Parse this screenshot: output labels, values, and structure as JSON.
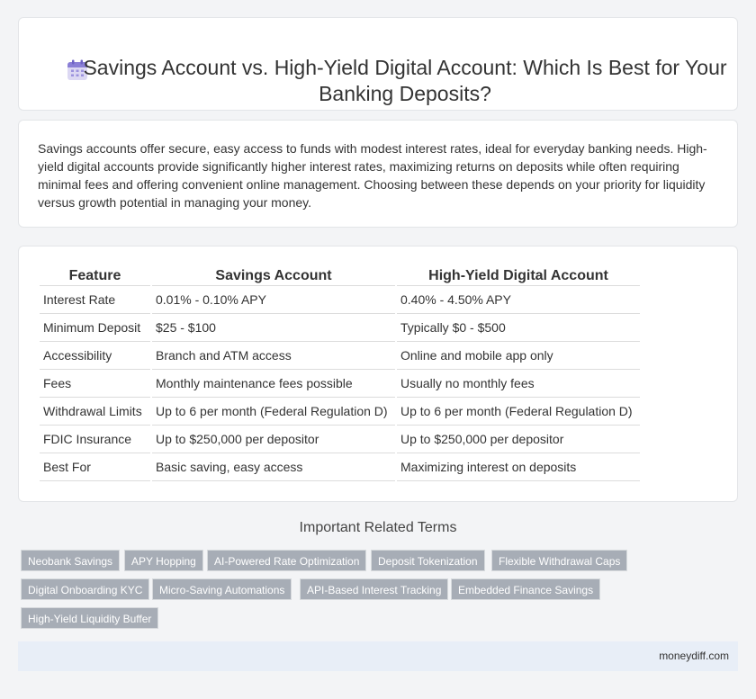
{
  "header": {
    "title": "Savings Account vs. High-Yield Digital Account: Which Is Best for Your Banking Deposits?",
    "icon": "calendar-icon"
  },
  "intro": {
    "text": "Savings accounts offer secure, easy access to funds with modest interest rates, ideal for everyday banking needs. High-yield digital accounts provide significantly higher interest rates, maximizing returns on deposits while often requiring minimal fees and offering convenient online management. Choosing between these depends on your priority for liquidity versus growth potential in managing your money."
  },
  "table": {
    "headers": [
      "Feature",
      "Savings Account",
      "High-Yield Digital Account"
    ],
    "rows": [
      [
        "Interest Rate",
        "0.01% - 0.10% APY",
        "0.40% - 4.50% APY"
      ],
      [
        "Minimum Deposit",
        "$25 - $100",
        "Typically $0 - $500"
      ],
      [
        "Accessibility",
        "Branch and ATM access",
        "Online and mobile app only"
      ],
      [
        "Fees",
        "Monthly maintenance fees possible",
        "Usually no monthly fees"
      ],
      [
        "Withdrawal Limits",
        "Up to 6 per month (Federal Regulation D)",
        "Up to 6 per month (Federal Regulation D)"
      ],
      [
        "FDIC Insurance",
        "Up to $250,000 per depositor",
        "Up to $250,000 per depositor"
      ],
      [
        "Best For",
        "Basic saving, easy access",
        "Maximizing interest on deposits"
      ]
    ]
  },
  "related": {
    "title": "Important Related Terms",
    "tags": [
      "Neobank Savings",
      "APY Hopping",
      "AI-Powered Rate Optimization",
      "Deposit Tokenization",
      "Flexible Withdrawal Caps",
      "Digital Onboarding KYC",
      "Micro-Saving Automations",
      "API-Based Interest Tracking",
      "Embedded Finance Savings",
      "High-Yield Liquidity Buffer"
    ]
  },
  "footer": {
    "site": "moneydiff.com"
  },
  "colors": {
    "tag_bg": "#a7adb6",
    "footer_bg": "#e8eef7",
    "icon_accent": "#8a7fd6"
  }
}
